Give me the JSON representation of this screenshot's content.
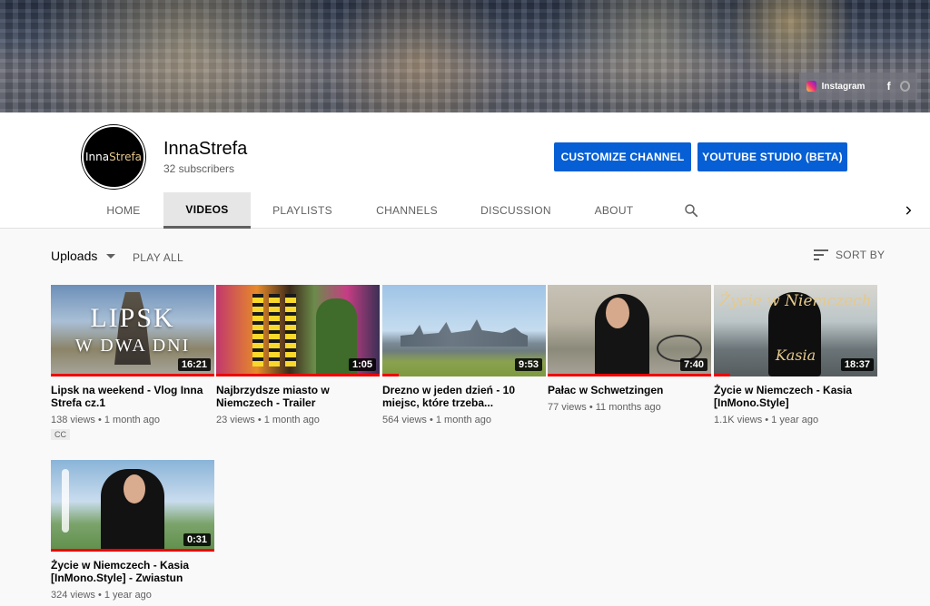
{
  "banner": {
    "social": {
      "instagram_label": "Instagram",
      "icons": [
        "instagram-icon",
        "facebook-icon",
        "google-icon"
      ]
    }
  },
  "channel": {
    "avatar_text_1": "Inna",
    "avatar_text_2": "Strefa",
    "name": "InnaStrefa",
    "subscribers": "32 subscribers",
    "customize_label": "CUSTOMIZE CHANNEL",
    "studio_label": "YOUTUBE STUDIO (BETA)",
    "accent_color": "#065fd4"
  },
  "tabs": [
    {
      "label": "HOME"
    },
    {
      "label": "VIDEOS",
      "active": true
    },
    {
      "label": "PLAYLISTS"
    },
    {
      "label": "CHANNELS"
    },
    {
      "label": "DISCUSSION"
    },
    {
      "label": "ABOUT"
    }
  ],
  "toolbar": {
    "uploads_label": "Uploads",
    "play_all_label": "PLAY ALL",
    "sort_label": "SORT BY"
  },
  "videos": [
    {
      "title": "Lipsk na weekend - Vlog Inna Strefa cz.1",
      "meta": "138 views • 1 month ago",
      "duration": "16:21",
      "badge": "CC",
      "thumb_text_1": "LIPSK",
      "thumb_text_2": "W DWA DNI"
    },
    {
      "title": "Najbrzydsze miasto w Niemczech - Trailer",
      "meta": "23 views • 1 month ago",
      "duration": "1:05"
    },
    {
      "title": "Drezno w jeden dzień - 10 miejsc, które trzeba...",
      "meta": "564 views • 1 month ago",
      "duration": "9:53"
    },
    {
      "title": "Pałac w Schwetzingen",
      "meta": "77 views • 11 months ago",
      "duration": "7:40"
    },
    {
      "title": "Życie w Niemczech - Kasia [InMono.Style]",
      "meta": "1.1K views • 1 year ago",
      "duration": "18:37",
      "thumb_text_1": "Życie w Niemczech",
      "thumb_text_2": "Kasia"
    },
    {
      "title": "Życie w Niemczech - Kasia [InMono.Style] - Zwiastun",
      "meta": "324 views • 1 year ago",
      "duration": "0:31"
    }
  ]
}
